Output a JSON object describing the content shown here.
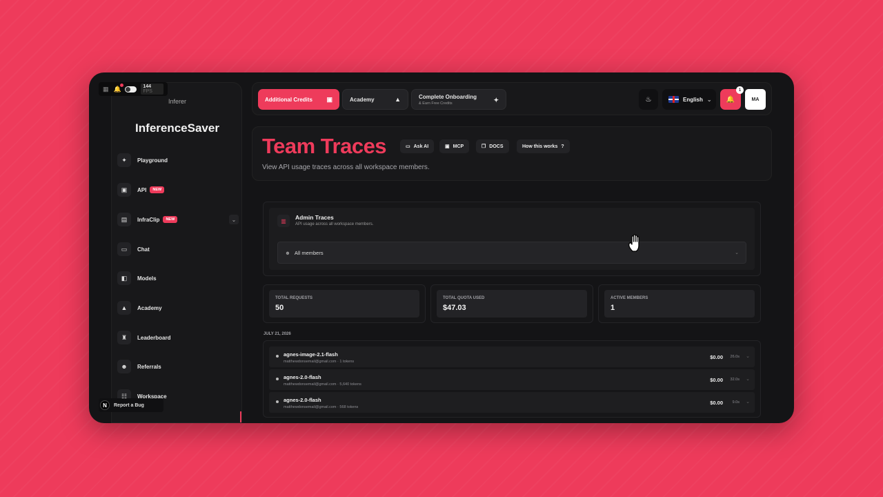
{
  "devbar": {
    "fps": "144",
    "fps_unit": "FPS"
  },
  "sidebar": {
    "logo_alt": "Inferer",
    "brand": "InferenceSaver",
    "items": [
      {
        "label": "Playground",
        "icon": "sparkle-icon"
      },
      {
        "label": "API",
        "icon": "code-icon",
        "badge": "NEW"
      },
      {
        "label": "InfraClip",
        "icon": "clip-icon",
        "badge": "NEW",
        "has_chevron": true
      },
      {
        "label": "Chat",
        "icon": "chat-icon"
      },
      {
        "label": "Models",
        "icon": "cube-icon"
      },
      {
        "label": "Academy",
        "icon": "graduation-cap-icon"
      },
      {
        "label": "Leaderboard",
        "icon": "trophy-icon"
      },
      {
        "label": "Referrals",
        "icon": "users-icon"
      },
      {
        "label": "Workspace",
        "icon": "workspace-icon"
      }
    ],
    "report_bug": "Report a Bug",
    "report_bug_badge": "N"
  },
  "topbar": {
    "credits": "Additional Credits",
    "academy": "Academy",
    "onboarding": "Complete Onboarding",
    "onboarding_sub": "& Earn Free Credits",
    "language": "English",
    "notifications": "1",
    "avatar": "MA"
  },
  "header": {
    "title": "Team Traces",
    "subtitle": "View API usage traces across all workspace members.",
    "pills": [
      "Ask AI",
      "MCP",
      "DOCS",
      "How this works"
    ]
  },
  "admin": {
    "title": "Admin Traces",
    "subtitle": "API usage across all workspace members.",
    "select_value": "All members"
  },
  "stats": [
    {
      "label": "Total Requests",
      "value": "50"
    },
    {
      "label": "Total Quota Used",
      "value": "$47.03"
    },
    {
      "label": "Active Members",
      "value": "1"
    }
  ],
  "date_label": "JULY 21, 2026",
  "traces": [
    {
      "model": "agnes-image-2.1-flash",
      "meta": "matthewdonsemail@gmail.com · 1 tokens",
      "cost": "$0.00",
      "duration": "26.0s"
    },
    {
      "model": "agnes-2.0-flash",
      "meta": "matthewdonsemail@gmail.com · 5,640 tokens",
      "cost": "$0.00",
      "duration": "32.0s"
    },
    {
      "model": "agnes-2.0-flash",
      "meta": "matthewdonsemail@gmail.com · 568 tokens",
      "cost": "$0.00",
      "duration": "9.0s"
    }
  ],
  "colors": {
    "accent": "#ee3b5b",
    "background": "#141416",
    "panel": "#18181a"
  }
}
